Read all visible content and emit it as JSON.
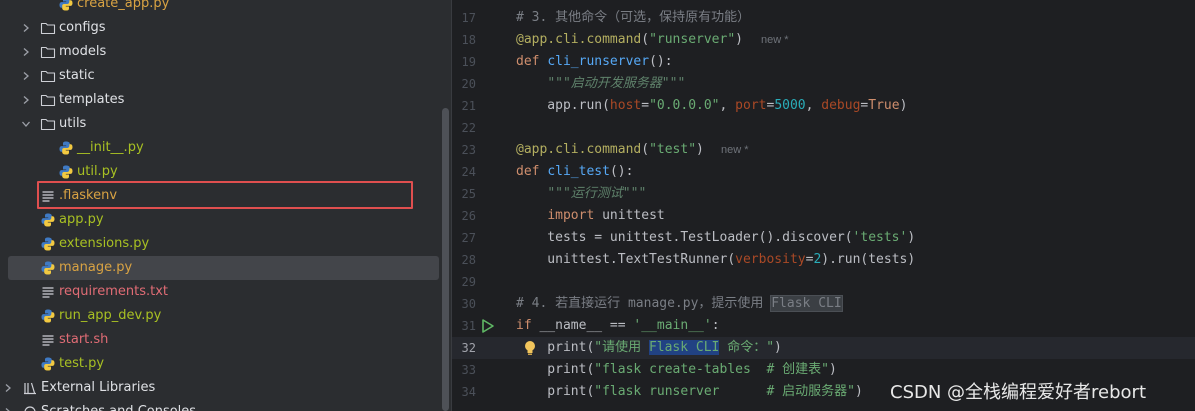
{
  "project_tree": {
    "items": [
      {
        "label": "create_app.py",
        "icon": "python-file-icon",
        "style": "orange"
      },
      {
        "label": "configs",
        "icon": "folder-icon",
        "expandable": true
      },
      {
        "label": "models",
        "icon": "folder-icon",
        "expandable": true
      },
      {
        "label": "static",
        "icon": "folder-icon",
        "expandable": true
      },
      {
        "label": "templates",
        "icon": "folder-icon",
        "expandable": true
      },
      {
        "label": "utils",
        "icon": "folder-icon",
        "expandable": true,
        "expanded": true
      },
      {
        "label": "__init__.py",
        "icon": "python-file-icon",
        "style": "yellowgreen"
      },
      {
        "label": "util.py",
        "icon": "python-file-icon",
        "style": "yellowgreen"
      },
      {
        "label": ".flaskenv",
        "icon": "text-file-icon",
        "style": "orange"
      },
      {
        "label": "app.py",
        "icon": "python-file-icon",
        "style": "yellowgreen"
      },
      {
        "label": "extensions.py",
        "icon": "python-file-icon",
        "style": "yellowgreen"
      },
      {
        "label": "manage.py",
        "icon": "python-file-icon",
        "style": "orange",
        "selected": true
      },
      {
        "label": "requirements.txt",
        "icon": "text-file-icon",
        "style": "red"
      },
      {
        "label": "run_app_dev.py",
        "icon": "python-file-icon",
        "style": "yellowgreen"
      },
      {
        "label": "start.sh",
        "icon": "shell-file-icon",
        "style": "red"
      },
      {
        "label": "test.py",
        "icon": "python-file-icon",
        "style": "yellowgreen"
      },
      {
        "label": "External Libraries",
        "icon": "library-icon",
        "expandable": true
      },
      {
        "label": "Scratches and Consoles",
        "icon": "scratches-icon",
        "expandable": true
      }
    ]
  },
  "editor": {
    "current_line": "32",
    "hints": {
      "line18": "new *",
      "line23": "new *"
    },
    "lines": [
      {
        "n": "17",
        "tokens": [
          [
            "cmt",
            "# 3. 其他命令（可选，保持原有功能）"
          ]
        ]
      },
      {
        "n": "18",
        "tokens": [
          [
            "deco",
            "@app.cli.command"
          ],
          [
            "plain",
            "("
          ],
          [
            "str",
            "\"runserver\""
          ],
          [
            "plain",
            ")"
          ]
        ]
      },
      {
        "n": "19",
        "tokens": [
          [
            "kw",
            "def "
          ],
          [
            "fn",
            "cli_runserver"
          ],
          [
            "plain",
            "():"
          ]
        ]
      },
      {
        "n": "20",
        "tokens": [
          [
            "plain",
            "    "
          ],
          [
            "doc",
            "\"\"\"启动开发服务器\"\"\""
          ]
        ]
      },
      {
        "n": "21",
        "tokens": [
          [
            "plain",
            "    app.run("
          ],
          [
            "param",
            "host"
          ],
          [
            "plain",
            "="
          ],
          [
            "str",
            "\"0.0.0.0\""
          ],
          [
            "plain",
            ", "
          ],
          [
            "param",
            "port"
          ],
          [
            "plain",
            "="
          ],
          [
            "num",
            "5000"
          ],
          [
            "plain",
            ", "
          ],
          [
            "param",
            "debug"
          ],
          [
            "plain",
            "="
          ],
          [
            "kw",
            "True"
          ],
          [
            "plain",
            ")"
          ]
        ]
      },
      {
        "n": "22",
        "tokens": []
      },
      {
        "n": "23",
        "tokens": [
          [
            "deco",
            "@app.cli.command"
          ],
          [
            "plain",
            "("
          ],
          [
            "str",
            "\"test\""
          ],
          [
            "plain",
            ")"
          ]
        ]
      },
      {
        "n": "24",
        "tokens": [
          [
            "kw",
            "def "
          ],
          [
            "fn",
            "cli_test"
          ],
          [
            "plain",
            "():"
          ]
        ]
      },
      {
        "n": "25",
        "tokens": [
          [
            "plain",
            "    "
          ],
          [
            "doc",
            "\"\"\"运行测试\"\"\""
          ]
        ]
      },
      {
        "n": "26",
        "tokens": [
          [
            "plain",
            "    "
          ],
          [
            "kw",
            "import "
          ],
          [
            "plain",
            "unittest"
          ]
        ]
      },
      {
        "n": "27",
        "tokens": [
          [
            "plain",
            "    tests = unittest.TestLoader().discover("
          ],
          [
            "str",
            "'tests'"
          ],
          [
            "plain",
            ")"
          ]
        ]
      },
      {
        "n": "28",
        "tokens": [
          [
            "plain",
            "    unittest.TextTestRunner("
          ],
          [
            "param",
            "verbosity"
          ],
          [
            "plain",
            "="
          ],
          [
            "num",
            "2"
          ],
          [
            "plain",
            ").run(tests)"
          ]
        ]
      },
      {
        "n": "29",
        "tokens": []
      },
      {
        "n": "30",
        "tokens": [
          [
            "cmt",
            "# 4. 若直接运行 manage.py，提示使用 "
          ],
          [
            "cmt hl-box",
            "Flask CLI"
          ]
        ]
      },
      {
        "n": "31",
        "tokens": [
          [
            "kw",
            "if "
          ],
          [
            "plain",
            "__name__ == "
          ],
          [
            "str",
            "'__main__'"
          ],
          [
            "plain",
            ":"
          ]
        ]
      },
      {
        "n": "32",
        "tokens": [
          [
            "plain",
            "    print("
          ],
          [
            "str",
            "\"请使用 "
          ],
          [
            "str hl-sel",
            "Flask CLI"
          ],
          [
            "str",
            " 命令：\""
          ],
          [
            "plain",
            ")"
          ]
        ]
      },
      {
        "n": "33",
        "tokens": [
          [
            "plain",
            "    print("
          ],
          [
            "str",
            "\"flask create-tables  # 创建表\""
          ],
          [
            "plain",
            ")"
          ]
        ]
      },
      {
        "n": "34",
        "tokens": [
          [
            "plain",
            "    print("
          ],
          [
            "str",
            "\"flask runserver      # 启动服务器\""
          ],
          [
            "plain",
            ")"
          ]
        ]
      }
    ]
  },
  "watermark": "CSDN @全栈编程爱好者rebort",
  "colors": {
    "highlight_box": "#e04f4f",
    "selection": "#43454a",
    "background": "#2b2d30"
  }
}
